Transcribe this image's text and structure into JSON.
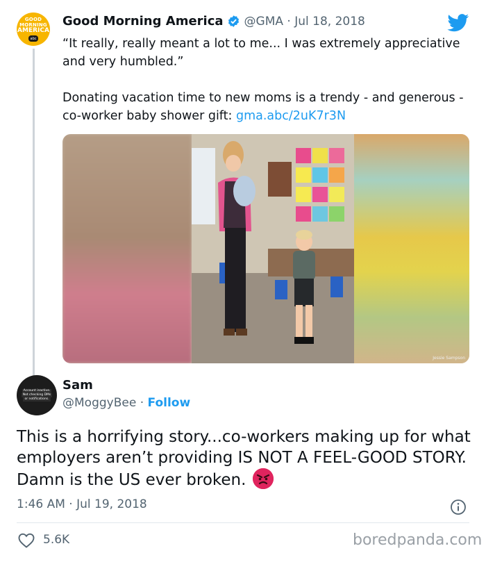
{
  "quoted_tweet": {
    "author_name": "Good Morning America",
    "handle_date": "@GMA · Jul 18, 2018",
    "avatar_lines": [
      "GOOD",
      "MORNING",
      "AMERICA"
    ],
    "avatar_badge": "abc",
    "paragraph1": "“It really, really meant a lot to me... I was extremely appreciative and very humbled.”",
    "paragraph2": "Donating vacation time to new moms is a trendy - and generous - co-worker baby shower gift: ",
    "link": "gma.abc/2uK7r3N",
    "photo_credit": "Jessie Sampson"
  },
  "tweet": {
    "author_name": "Sam",
    "handle": "@MoggyBee",
    "separator": " · ",
    "follow_label": "Follow",
    "avatar_lines": [
      "Account inactive.",
      "Not checking DMs",
      "or notifications."
    ],
    "body": "This is a horrifying story...co-workers making up for what employers aren’t providing IS NOT A FEEL-GOOD STORY. Damn is the US ever broken. ",
    "timestamp": "1:46 AM · Jul 19, 2018",
    "likes": "5.6K"
  },
  "watermark": "boredpanda.com",
  "icons": [
    "verified-badge-icon",
    "twitter-bird-icon",
    "angry-face-icon",
    "info-icon",
    "heart-icon"
  ],
  "colors": {
    "link_blue": "#1d9bf0",
    "secondary_text": "#536471",
    "gma_yellow": "#f7b500"
  }
}
